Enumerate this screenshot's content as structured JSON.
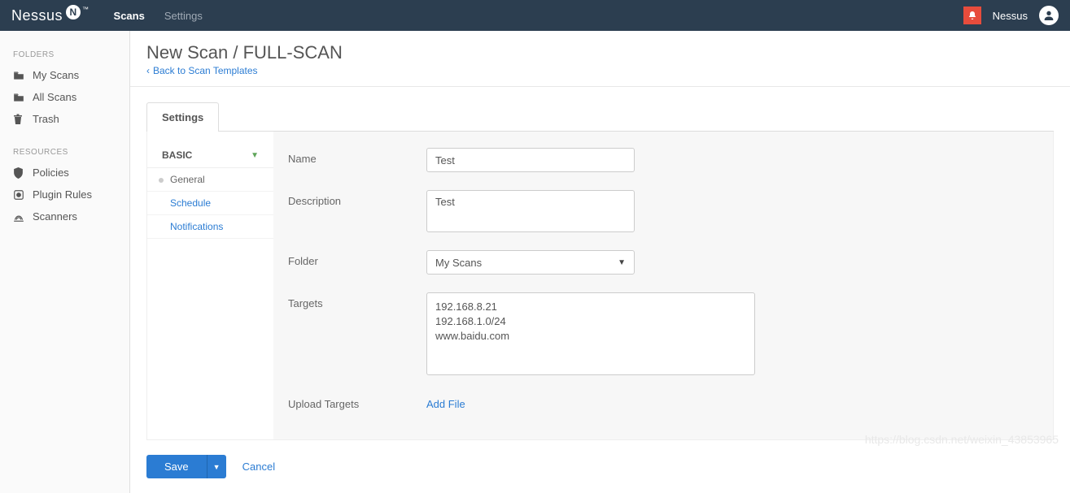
{
  "topbar": {
    "logo_text": "Nessus",
    "logo_badge": "N",
    "nav": {
      "scans": "Scans",
      "settings": "Settings"
    },
    "user_label": "Nessus"
  },
  "sidebar": {
    "heading_folders": "FOLDERS",
    "folders": [
      {
        "label": "My Scans",
        "icon": "folder"
      },
      {
        "label": "All Scans",
        "icon": "folder"
      },
      {
        "label": "Trash",
        "icon": "trash"
      }
    ],
    "heading_resources": "RESOURCES",
    "resources": [
      {
        "label": "Policies",
        "icon": "shield"
      },
      {
        "label": "Plugin Rules",
        "icon": "plugin"
      },
      {
        "label": "Scanners",
        "icon": "scanner"
      }
    ]
  },
  "page": {
    "title": "New Scan / FULL-SCAN",
    "back_link": "Back to Scan Templates"
  },
  "tabs": {
    "settings": "Settings"
  },
  "panel_nav": {
    "section": "BASIC",
    "items": {
      "general": "General",
      "schedule": "Schedule",
      "notifications": "Notifications"
    }
  },
  "form": {
    "name_label": "Name",
    "name_value": "Test",
    "description_label": "Description",
    "description_value": "Test",
    "folder_label": "Folder",
    "folder_value": "My Scans",
    "targets_label": "Targets",
    "targets_value": "192.168.8.21\n192.168.1.0/24\nwww.baidu.com",
    "upload_label": "Upload Targets",
    "add_file": "Add File"
  },
  "footer": {
    "save": "Save",
    "cancel": "Cancel"
  },
  "watermark": "https://blog.csdn.net/weixin_43853965"
}
